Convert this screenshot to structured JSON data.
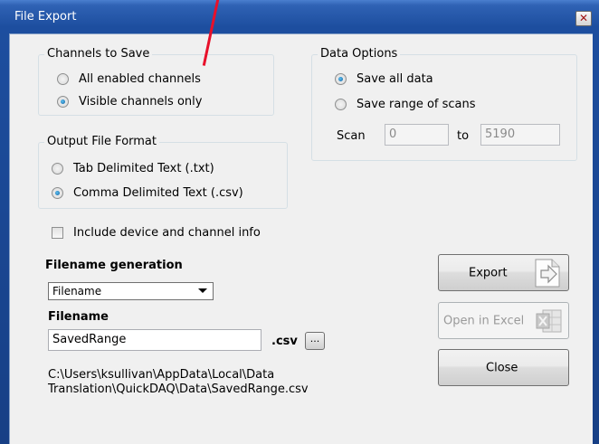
{
  "window": {
    "title": "File Export",
    "close_glyph": "✕"
  },
  "channels": {
    "legend": "Channels to Save",
    "options": [
      "All enabled channels",
      "Visible channels only"
    ],
    "selected": 1
  },
  "data_options": {
    "legend": "Data Options",
    "options": [
      "Save all data",
      "Save range of scans"
    ],
    "selected": 0,
    "scan_label": "Scan",
    "scan_from": "0",
    "to_label": "to",
    "scan_to": "5190"
  },
  "format": {
    "legend": "Output File Format",
    "options": [
      "Tab Delimited Text (.txt)",
      "Comma Delimited Text (.csv)"
    ],
    "selected": 1
  },
  "include_info": {
    "label": "Include device and channel info",
    "checked": false
  },
  "filename_generation": {
    "label": "Filename generation",
    "value": "Filename"
  },
  "filename": {
    "label": "Filename",
    "value": "SavedRange",
    "extension": ".csv",
    "browse_label": "..."
  },
  "path": {
    "line1": "C:\\Users\\ksullivan\\AppData\\Local\\Data",
    "line2": "Translation\\QuickDAQ\\Data\\SavedRange.csv"
  },
  "buttons": {
    "export": "Export",
    "open_excel": "Open in Excel",
    "close": "Close"
  },
  "icons": {
    "export": "export-arrow-icon",
    "excel": "excel-icon"
  }
}
